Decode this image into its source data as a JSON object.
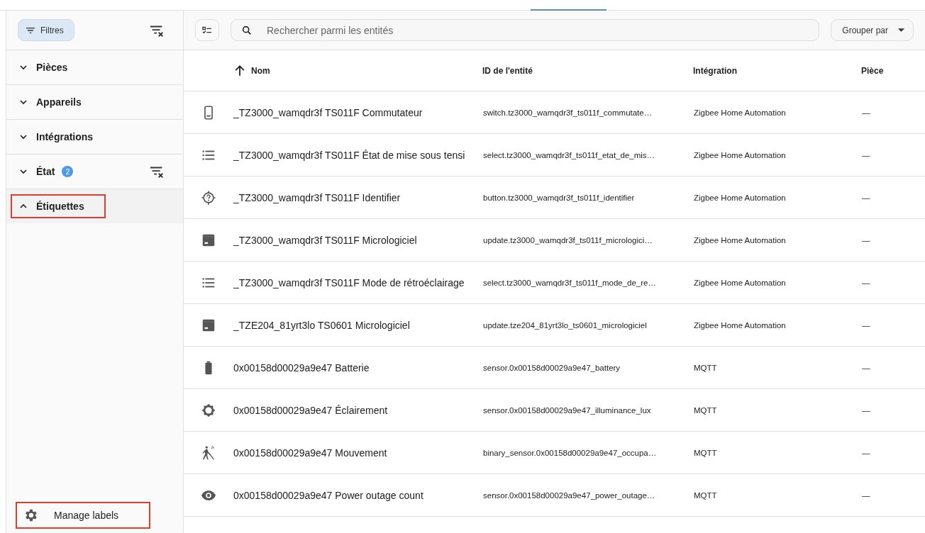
{
  "filters_button": {
    "label": "Filtres",
    "selected": true
  },
  "filter_sections": [
    {
      "label": "Pièces",
      "expanded": false,
      "highlighted": false
    },
    {
      "label": "Appareils",
      "expanded": false,
      "highlighted": false
    },
    {
      "label": "Intégrations",
      "expanded": false,
      "highlighted": false
    },
    {
      "label": "État",
      "expanded": false,
      "badge": "2",
      "highlighted": false
    },
    {
      "label": "Étiquettes",
      "expanded": true,
      "highlighted": true
    }
  ],
  "manage_labels": {
    "label": "Manage labels",
    "highlighted": true
  },
  "search": {
    "placeholder": "Rechercher parmi les entités"
  },
  "group_by": {
    "label": "Grouper par"
  },
  "table": {
    "columns": [
      {
        "label": "Nom",
        "sorted": true
      },
      {
        "label": "ID de l'entité",
        "sorted": false
      },
      {
        "label": "Intégration",
        "sorted": false
      },
      {
        "label": "Pièce",
        "sorted": false
      }
    ],
    "rows": [
      {
        "kind": "switch",
        "name": "_TZ3000_wamqdr3f TS011F Commutateur",
        "entity_id": "switch.tz3000_wamqdr3f_ts011f_commutate…",
        "integration": "Zigbee Home Automation",
        "area": "—"
      },
      {
        "kind": "select",
        "name": "_TZ3000_wamqdr3f TS011F État de mise sous tensi",
        "entity_id": "select.tz3000_wamqdr3f_ts011f_etat_de_mis…",
        "integration": "Zigbee Home Automation",
        "area": "—"
      },
      {
        "kind": "identify",
        "name": "_TZ3000_wamqdr3f TS011F Identifier",
        "entity_id": "button.tz3000_wamqdr3f_ts011f_identifier",
        "integration": "Zigbee Home Automation",
        "area": "—"
      },
      {
        "kind": "update",
        "name": "_TZ3000_wamqdr3f TS011F Micrologiciel",
        "entity_id": "update.tz3000_wamqdr3f_ts011f_micrologici…",
        "integration": "Zigbee Home Automation",
        "area": "—"
      },
      {
        "kind": "select",
        "name": "_TZ3000_wamqdr3f TS011F Mode de rétroéclairage",
        "entity_id": "select.tz3000_wamqdr3f_ts011f_mode_de_re…",
        "integration": "Zigbee Home Automation",
        "area": "—"
      },
      {
        "kind": "update",
        "name": "_TZE204_81yrt3lo TS0601 Micrologiciel",
        "entity_id": "update.tze204_81yrt3lo_ts0601_micrologiciel",
        "integration": "Zigbee Home Automation",
        "area": "—"
      },
      {
        "kind": "battery",
        "name": "0x00158d00029a9e47 Batterie",
        "entity_id": "sensor.0x00158d00029a9e47_battery",
        "integration": "MQTT",
        "area": "—"
      },
      {
        "kind": "brightness",
        "name": "0x00158d00029a9e47 Éclairement",
        "entity_id": "sensor.0x00158d00029a9e47_illuminance_lux",
        "integration": "MQTT",
        "area": "—"
      },
      {
        "kind": "motion",
        "name": "0x00158d00029a9e47 Mouvement",
        "entity_id": "binary_sensor.0x00158d00029a9e47_occupa…",
        "integration": "MQTT",
        "area": "—"
      },
      {
        "kind": "eye",
        "name": "0x00158d00029a9e47 Power outage count",
        "entity_id": "sensor.0x00158d00029a9e47_power_outage…",
        "integration": "MQTT",
        "area": "—"
      }
    ]
  }
}
